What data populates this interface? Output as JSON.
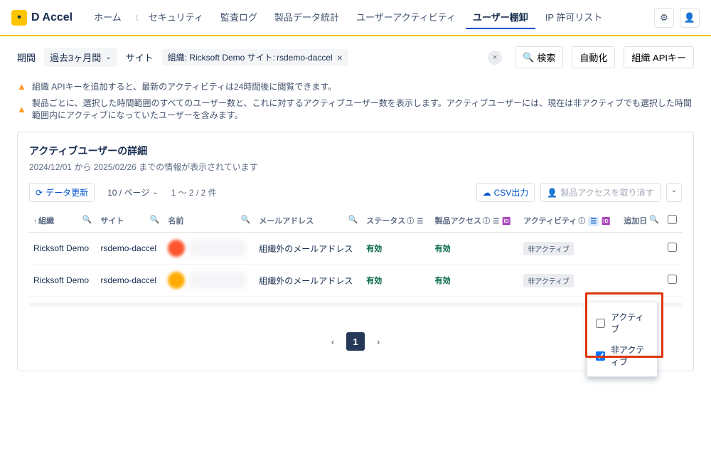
{
  "logo": {
    "text": "D Accel"
  },
  "nav": {
    "items": [
      "ホーム",
      "セキュリティ",
      "監査ログ",
      "製品データ統計",
      "ユーザーアクティビティ",
      "ユーザー棚卸",
      "IP 許可リスト"
    ],
    "active_index": 5
  },
  "filters": {
    "period_label": "期間",
    "period_value": "過去3ヶ月間",
    "site_label": "サイト",
    "chip_prefix": "組織: Ricksoft Demo  サイト: ",
    "chip_value": "rsdemo-daccel",
    "search_btn": "検索",
    "automation_btn": "自動化",
    "api_btn": "組織 APIキー"
  },
  "warnings": [
    "組織 APIキーを追加すると、最新のアクティビティは24時間後に閲覧できます。",
    "製品ごとに、選択した時間範囲のすべてのユーザー数と、これに対するアクティブユーザー数を表示します。アクティブユーザーには、現在は非アクティブでも選択した時間範囲内にアクティブになっていたユーザーを含みます。"
  ],
  "section": {
    "title": "アクティブユーザーの詳細",
    "subtitle": "2024/12/01 から 2025/02/26 までの情報が表示されています"
  },
  "toolbar": {
    "refresh": "データ更新",
    "per_page": "10 / ページ",
    "count": "1 〜 2 / 2 件",
    "csv": "CSV出力",
    "revoke": "製品アクセスを取り消す"
  },
  "columns": {
    "org": "組織",
    "site": "サイト",
    "name": "名前",
    "email": "メールアドレス",
    "status": "ステータス",
    "access": "製品アクセス",
    "activity": "アクティビティ",
    "added": "追加日"
  },
  "rows": [
    {
      "org": "Ricksoft Demo",
      "site": "rsdemo-daccel",
      "email": "組織外のメールアドレス",
      "status": "有効",
      "access": "有効",
      "activity": "非アクティブ"
    },
    {
      "org": "Ricksoft Demo",
      "site": "rsdemo-daccel",
      "email": "組織外のメールアドレス",
      "status": "有効",
      "access": "有効",
      "activity": "非アクティブ"
    }
  ],
  "filter_popup": {
    "option1": "アクティブ",
    "option2": "非アクティブ"
  },
  "pagination": {
    "current": "1"
  }
}
